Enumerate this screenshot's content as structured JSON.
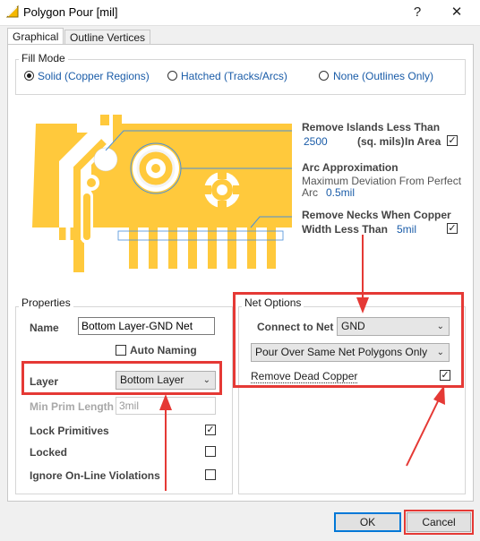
{
  "window": {
    "title": "Polygon Pour [mil]",
    "help_glyph": "?",
    "close_glyph": "✕"
  },
  "tabs": [
    {
      "label": "Graphical",
      "active": true
    },
    {
      "label": "Outline Vertices",
      "active": false
    }
  ],
  "fill_mode": {
    "title": "Fill Mode",
    "options": [
      {
        "label": "Solid (Copper Regions)",
        "selected": true
      },
      {
        "label": "Hatched (Tracks/Arcs)",
        "selected": false
      },
      {
        "label": "None (Outlines Only)",
        "selected": false
      }
    ]
  },
  "preview": {
    "remove_islands": {
      "label": "Remove Islands Less Than",
      "value": "2500",
      "unit": "(sq. mils)",
      "suffix": "In Area",
      "checked": true
    },
    "arc_approx": {
      "label": "Arc Approximation",
      "desc1": "Maximum Deviation From Perfect",
      "desc2": "Arc",
      "value": "0.5mil"
    },
    "remove_necks": {
      "label1": "Remove Necks When Copper",
      "label2": "Width Less Than",
      "value": "5mil",
      "checked": true
    },
    "copper_color": "#ffc93c"
  },
  "properties": {
    "title": "Properties",
    "name_label": "Name",
    "name_value": "Bottom Layer-GND Net",
    "auto_naming": {
      "label": "Auto Naming",
      "checked": false
    },
    "layer_label": "Layer",
    "layer_value": "Bottom Layer",
    "min_prim_label": "Min Prim Length",
    "min_prim_value": "3mil",
    "lock_primitives": {
      "label": "Lock Primitives",
      "checked": true
    },
    "locked": {
      "label": "Locked",
      "checked": false
    },
    "ignore_online": {
      "label": "Ignore On-Line Violations",
      "checked": false
    }
  },
  "net_options": {
    "title": "Net Options",
    "connect_label": "Connect to Net",
    "connect_value": "GND",
    "pour_mode": "Pour Over Same Net Polygons Only",
    "remove_dead": {
      "label": "Remove Dead Copper",
      "checked": true
    }
  },
  "buttons": {
    "ok": "OK",
    "cancel": "Cancel"
  },
  "colors": {
    "annotation": "#e53935",
    "link_blue": "#1a5ca8",
    "accent": "#0078d7"
  }
}
